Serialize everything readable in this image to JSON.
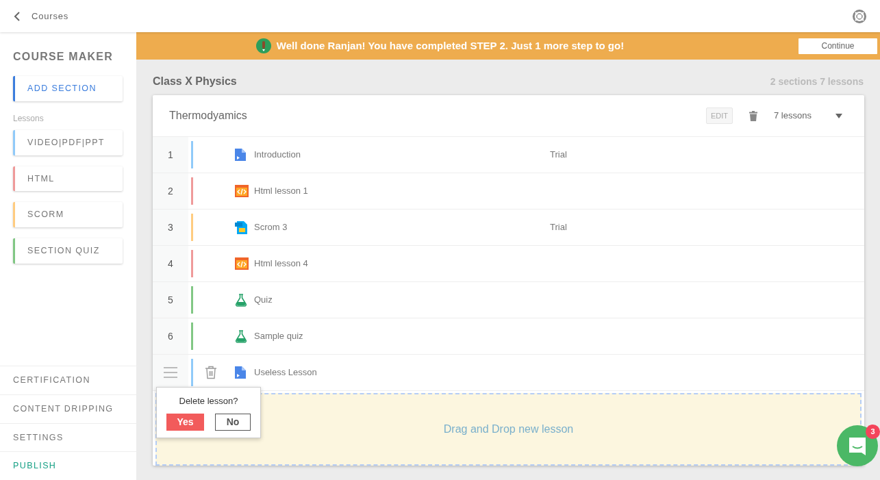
{
  "topbar": {
    "back_label": "Courses"
  },
  "sidebar": {
    "title": "COURSE MAKER",
    "add_button": {
      "label": "ADD SECTION",
      "color": "#3b7ddd"
    },
    "lessons_label": "Lessons",
    "lesson_types": [
      {
        "label": "VIDEO|PDF|PPT",
        "color": "#90caf9"
      },
      {
        "label": "HTML",
        "color": "#ef9a9a"
      },
      {
        "label": "SCORM",
        "color": "#ffcc80"
      },
      {
        "label": "SECTION QUIZ",
        "color": "#81c784"
      }
    ],
    "footer_items": [
      {
        "label": "CERTIFICATION",
        "kind": "link"
      },
      {
        "label": "CONTENT DRIPPING",
        "kind": "link"
      },
      {
        "label": "SETTINGS",
        "kind": "link"
      },
      {
        "label": "PUBLISH",
        "kind": "action"
      }
    ]
  },
  "banner": {
    "message": "Well done Ranjan! You have completed STEP 2. Just 1 more step to go!",
    "button": "Continue"
  },
  "course": {
    "title": "Class X Physics",
    "summary": "2 sections 7 lessons"
  },
  "section": {
    "title": "Thermodyamics",
    "edit_button": "EDIT",
    "lesson_count": "7 lessons",
    "expanded": true,
    "lessons": [
      {
        "number": "1",
        "kind": "video",
        "title": "Introduction",
        "tag": "Trial",
        "hovered": false
      },
      {
        "number": "2",
        "kind": "html",
        "title": "Html lesson 1",
        "hovered": false
      },
      {
        "number": "3",
        "kind": "scorm",
        "title": "Scrom 3",
        "tag": "Trial",
        "hovered": false
      },
      {
        "number": "4",
        "kind": "html",
        "title": "Html lesson 4",
        "hovered": false
      },
      {
        "number": "5",
        "kind": "quiz",
        "title": "Quiz",
        "hovered": false
      },
      {
        "number": "6",
        "kind": "quiz",
        "title": "Sample quiz",
        "hovered": false
      },
      {
        "kind": "video",
        "title": "Useless Lesson",
        "hovered": true
      }
    ],
    "drop_zone": "Drag and Drop new lesson"
  },
  "delete_popover": {
    "question": "Delete lesson?",
    "yes": "Yes",
    "no": "No"
  },
  "chat": {
    "badge": "3"
  }
}
